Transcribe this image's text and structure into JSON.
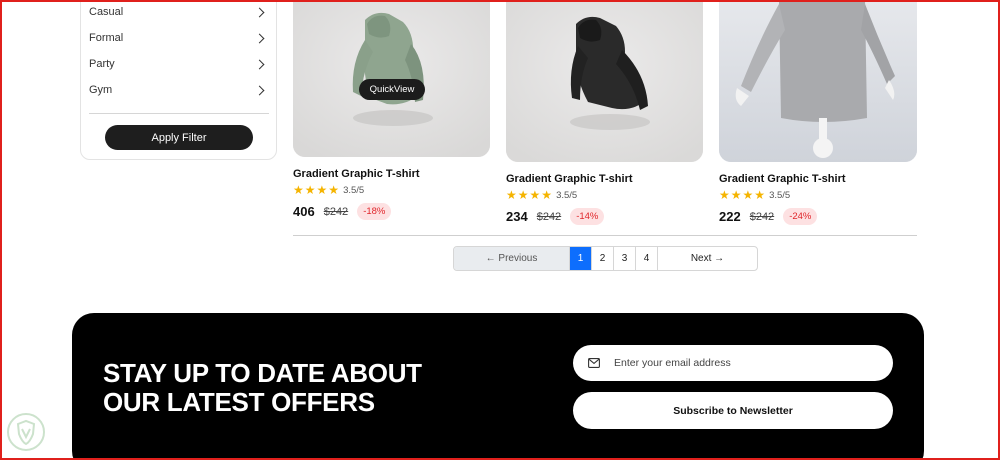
{
  "filters": {
    "items": [
      {
        "label": "Casual"
      },
      {
        "label": "Formal"
      },
      {
        "label": "Party"
      },
      {
        "label": "Gym"
      }
    ],
    "apply_label": "Apply Filter"
  },
  "products": [
    {
      "name": "Gradient Graphic T-shirt",
      "rating_text": "3.5/5",
      "rating": 3.5,
      "price": "406",
      "old_price": "$242",
      "discount": "-18%",
      "quickview_label": "QuickView",
      "image": "green-hoodie"
    },
    {
      "name": "Gradient Graphic T-shirt",
      "rating_text": "3.5/5",
      "rating": 3.5,
      "price": "234",
      "old_price": "$242",
      "discount": "-14%",
      "image": "black-hoodie"
    },
    {
      "name": "Gradient Graphic T-shirt",
      "rating_text": "3.5/5",
      "rating": 3.5,
      "price": "222",
      "old_price": "$242",
      "discount": "-24%",
      "image": "grey-sweater-mannequin"
    }
  ],
  "pagination": {
    "previous_label": "← Previous",
    "pages": [
      "1",
      "2",
      "3",
      "4"
    ],
    "active_page": "1",
    "next_label": "Next →"
  },
  "newsletter": {
    "title_line1": "STAY UP TO DATE ABOUT",
    "title_line2": "OUR LATEST OFFERS",
    "email_placeholder": "Enter your email address",
    "subscribe_label": "Subscribe to Newsletter"
  },
  "colors": {
    "accent": "#0d6efd",
    "star": "#f5b400",
    "discount_text": "#e0262b",
    "discount_bg": "#fde1e2",
    "frame": "#e0201c"
  }
}
